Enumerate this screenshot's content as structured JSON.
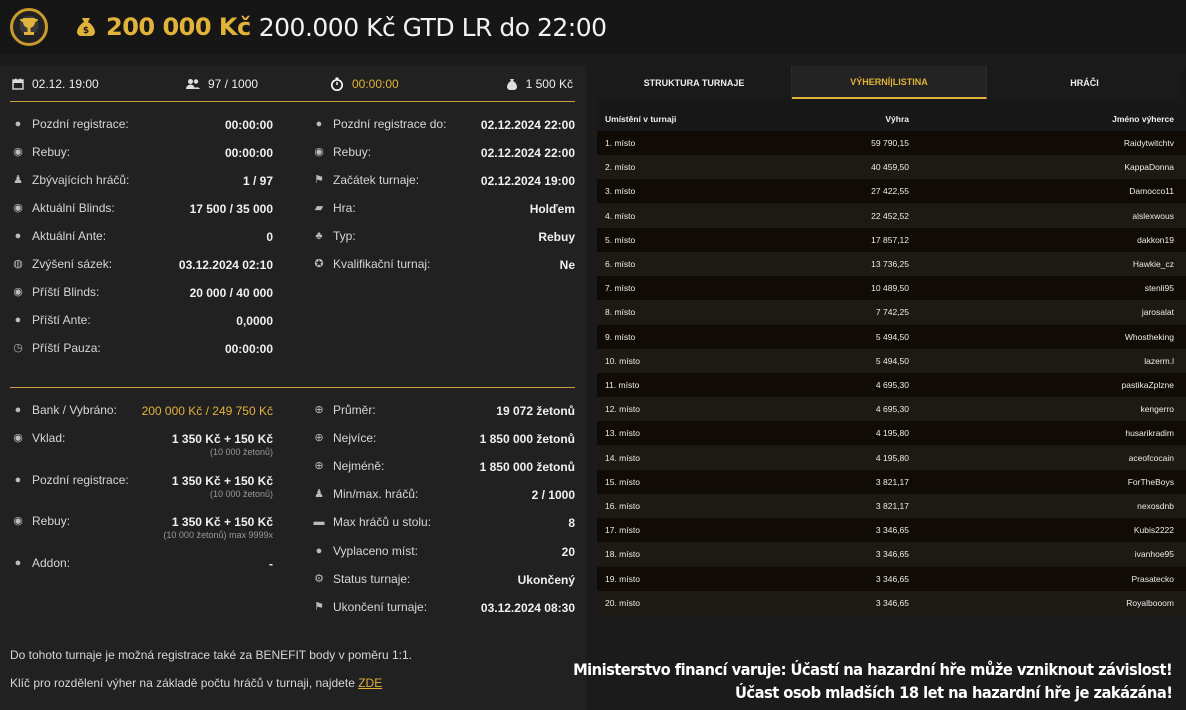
{
  "header": {
    "prize": "200 000 Kč",
    "title": "200.000 Kč GTD LR do 22:00"
  },
  "topbar": {
    "date": "02.12. 19:00",
    "players": "97 / 1000",
    "timer": "00:00:00",
    "buyin": "1 500 Kč"
  },
  "info_left": [
    {
      "icon": "user-clock-icon",
      "label": "Pozdní registrace:",
      "value": "00:00:00"
    },
    {
      "icon": "rebuy-icon",
      "label": "Rebuy:",
      "value": "00:00:00"
    },
    {
      "icon": "users-icon",
      "label": "Zbývajících hráčů:",
      "value": "1 / 97"
    },
    {
      "icon": "blinds-icon",
      "label": "Aktuální Blinds:",
      "value": "17 500 / 35 000"
    },
    {
      "icon": "coin-icon",
      "label": "Aktuální Ante:",
      "value": "0"
    },
    {
      "icon": "level-up-icon",
      "label": "Zvýšení sázek:",
      "value": "03.12.2024 02:10"
    },
    {
      "icon": "blinds-icon",
      "label": "Příští Blinds:",
      "value": "20 000 / 40 000"
    },
    {
      "icon": "coin-icon",
      "label": "Příští Ante:",
      "value": "0,0000"
    },
    {
      "icon": "clock-icon",
      "label": "Příští Pauza:",
      "value": "00:00:00"
    }
  ],
  "info_right": [
    {
      "icon": "user-clock-icon",
      "label": "Pozdní registrace do:",
      "value": "02.12.2024 22:00"
    },
    {
      "icon": "rebuy-icon",
      "label": "Rebuy:",
      "value": "02.12.2024 22:00"
    },
    {
      "icon": "flag-icon",
      "label": "Začátek turnaje:",
      "value": "02.12.2024 19:00"
    },
    {
      "icon": "cards-icon",
      "label": "Hra:",
      "value": "Holďem"
    },
    {
      "icon": "suits-icon",
      "label": "Typ:",
      "value": "Rebuy"
    },
    {
      "icon": "medal-icon",
      "label": "Kvalifikační turnaj:",
      "value": "Ne"
    }
  ],
  "money_left": [
    {
      "icon": "money-bag-icon",
      "label": "Bank / Vybráno:",
      "value": "200 000 Kč / 249 750 Kč",
      "sub": ""
    },
    {
      "icon": "deposit-icon",
      "label": "Vklad:",
      "value": "1 350 Kč + 150 Kč",
      "sub": "(10 000 žetonů)"
    },
    {
      "icon": "coin-icon",
      "label": "Pozdní registrace:",
      "value": "1 350 Kč + 150 Kč",
      "sub": "(10 000 žetonů)"
    },
    {
      "icon": "rebuy-icon",
      "label": "Rebuy:",
      "value": "1 350 Kč + 150 Kč",
      "sub": "(10 000 žetonů) max 9999x"
    },
    {
      "icon": "coin-icon",
      "label": "Addon:",
      "value": "-",
      "sub": ""
    }
  ],
  "money_right": [
    {
      "icon": "chip-icon",
      "label": "Průměr:",
      "value": "19 072 žetonů"
    },
    {
      "icon": "chip-icon",
      "label": "Nejvíce:",
      "value": "1 850 000 žetonů"
    },
    {
      "icon": "chip-icon",
      "label": "Nejméně:",
      "value": "1 850 000 žetonů"
    },
    {
      "icon": "users-icon",
      "label": "Min/max. hráčů:",
      "value": "2 / 1000"
    },
    {
      "icon": "table-icon",
      "label": "Max hráčů u stolu:",
      "value": "8"
    },
    {
      "icon": "payout-icon",
      "label": "Vyplaceno míst:",
      "value": "20"
    },
    {
      "icon": "cog-icon",
      "label": "Status turnaje:",
      "value": "Ukončený"
    },
    {
      "icon": "flag-icon",
      "label": "Ukončení turnaje:",
      "value": "03.12.2024 08:30"
    }
  ],
  "footer": {
    "line1": "Do tohoto turnaje je možná registrace také za BENEFIT body v poměru 1:1.",
    "line2": "Klíč pro rozdělení výher na základě počtu hráčů v turnaji, najdete",
    "link": "ZDE"
  },
  "tabs": [
    {
      "label": "STRUKTURA TURNAJE",
      "active": false
    },
    {
      "label": "VÝHERNÍ|LISTINA",
      "active": true
    },
    {
      "label": "HRÁČI",
      "active": false
    }
  ],
  "table": {
    "headers": [
      "Umístění v turnaji",
      "Výhra",
      "Jméno výherce"
    ],
    "rows": [
      [
        "1. místo",
        "59 790,15",
        "Raidytwitchtv"
      ],
      [
        "2. místo",
        "40 459,50",
        "KappaDonna"
      ],
      [
        "3. místo",
        "27 422,55",
        "Damocco11"
      ],
      [
        "4. místo",
        "22 452,52",
        "alslexwous"
      ],
      [
        "5. místo",
        "17 857,12",
        "dakkon19"
      ],
      [
        "6. místo",
        "13 736,25",
        "Hawkie_cz"
      ],
      [
        "7. místo",
        "10 489,50",
        "stenli95"
      ],
      [
        "8. místo",
        "7 742,25",
        "jarosalat"
      ],
      [
        "9. místo",
        "5 494,50",
        "Whostheking"
      ],
      [
        "10. místo",
        "5 494,50",
        "lazerm.l"
      ],
      [
        "11. místo",
        "4 695,30",
        "pastikaZplzne"
      ],
      [
        "12. místo",
        "4 695,30",
        "kengerro"
      ],
      [
        "13. místo",
        "4 195,80",
        "husarikradim"
      ],
      [
        "14. místo",
        "4 195,80",
        "aceofcocain"
      ],
      [
        "15. místo",
        "3 821,17",
        "ForTheBoys"
      ],
      [
        "16. místo",
        "3 821,17",
        "nexosdnb"
      ],
      [
        "17. místo",
        "3 346,65",
        "Kubis2222"
      ],
      [
        "18. místo",
        "3 346,65",
        "ivanhoe95"
      ],
      [
        "19. místo",
        "3 346,65",
        "Prasatecko"
      ],
      [
        "20. místo",
        "3 346,65",
        "Royalbooom"
      ]
    ]
  },
  "warning": {
    "line1": "Ministerstvo financí varuje: Účastí na hazardní hře může vzniknout závislost!",
    "line2": "Účast osob mladších 18 let na hazardní hře je zakázána!"
  },
  "colors": {
    "accent": "#e2b33a",
    "background": "#1b1b1b",
    "panel": "#212121"
  }
}
